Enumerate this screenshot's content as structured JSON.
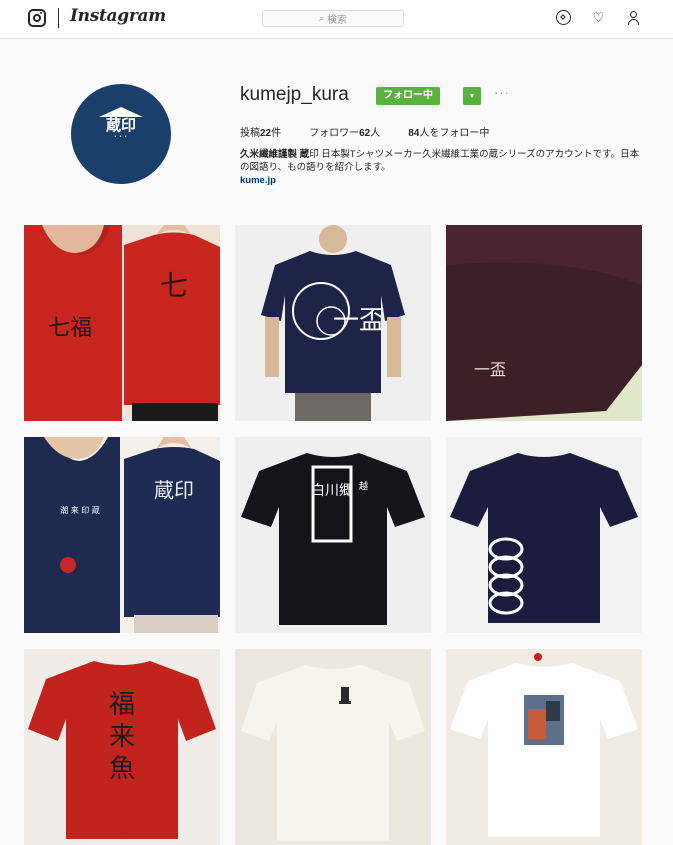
{
  "nav": {
    "wordmark": "Instagram",
    "search_placeholder": "検索",
    "icons": [
      "instagram-glyph-icon",
      "search-icon",
      "compass-icon",
      "heart-icon",
      "person-icon"
    ]
  },
  "profile": {
    "username": "kumejp_kura",
    "follow_label": "フォロー中",
    "dropdown_label": "▾",
    "more_label": "···",
    "avatar": {
      "kanji": "蔵印",
      "colors": {
        "bg": "#1b3f6b",
        "fg": "#ffffff"
      }
    },
    "stats": {
      "posts": {
        "label": "投稿",
        "value": "22",
        "suffix": "件"
      },
      "followers": {
        "label": "フォロワー",
        "value": "62",
        "suffix": "人"
      },
      "following": {
        "value": "84",
        "suffix": "人をフォロー中"
      }
    },
    "bio": {
      "name": "久米繊維謹製 蔵",
      "text": "印 日本製Tシャツメーカー久米繊維工業の蔵シリーズのアカウントです。日本の図語り、もの語りを紹介します。",
      "link": "kume.jp"
    }
  },
  "colors": {
    "accent_green": "#5ab13f",
    "link": "#003569"
  },
  "grid": {
    "posts": [
      {
        "kind": "red-tshirt-front-back",
        "caption_kanji": "七福"
      },
      {
        "kind": "navy-tshirt-model",
        "caption_kanji": "一盃"
      },
      {
        "kind": "purple-tshirt-closeup",
        "caption_kanji": "一盃"
      },
      {
        "kind": "navy-tshirt-front-back",
        "caption_kanji": "蔵印"
      },
      {
        "kind": "black-tshirt-kanji",
        "caption_kanji": "白川郷"
      },
      {
        "kind": "navy-tshirt-rope",
        "caption_kanji": ""
      },
      {
        "kind": "red-tshirt-kanji",
        "caption_kanji": "福来魚"
      },
      {
        "kind": "white-tshirt-small-print",
        "caption_kanji": ""
      },
      {
        "kind": "white-tshirt-photo-print",
        "caption_kanji": ""
      }
    ]
  }
}
